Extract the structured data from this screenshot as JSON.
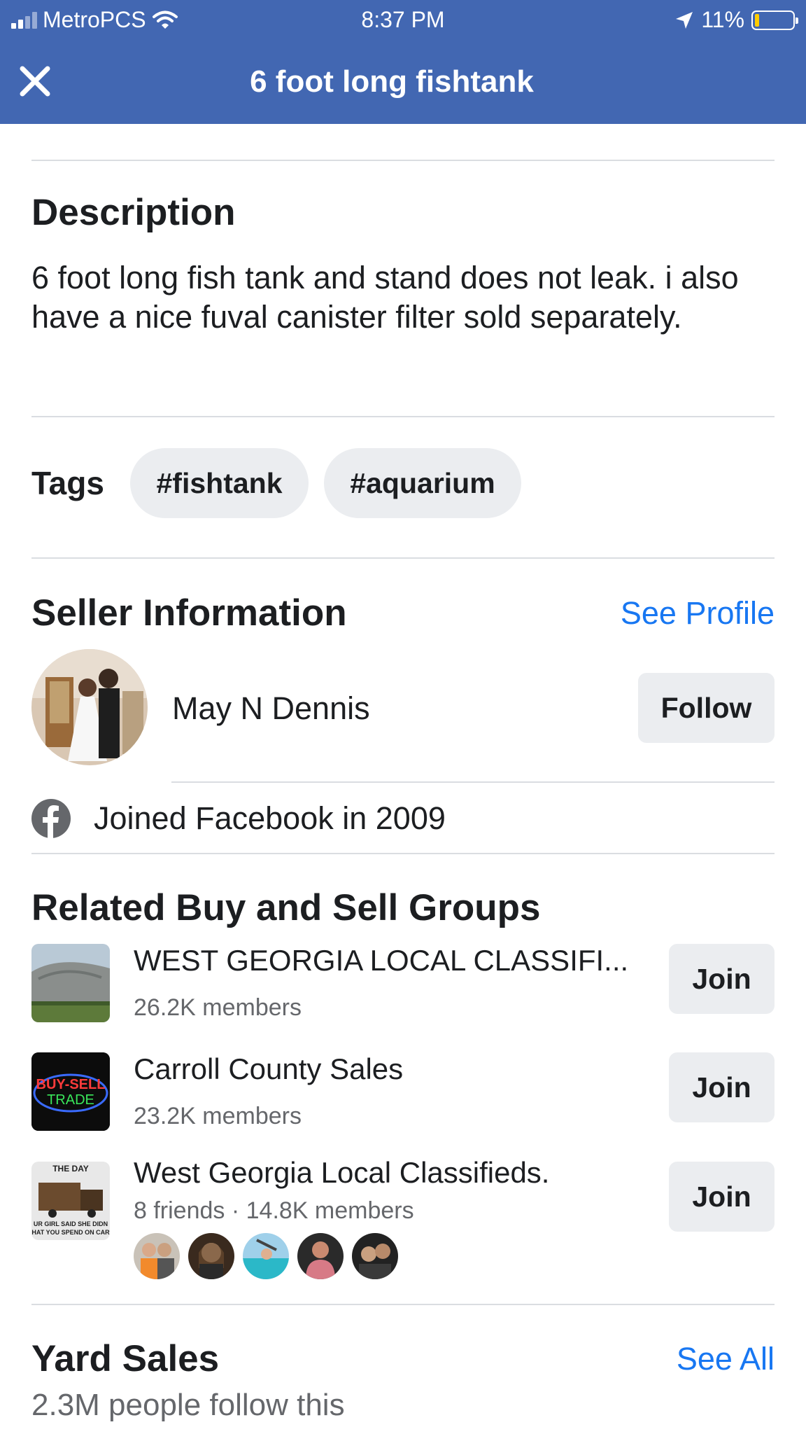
{
  "status_bar": {
    "carrier": "MetroPCS",
    "time": "8:37 PM",
    "battery": "11%",
    "battery_level": 0.11
  },
  "header": {
    "close_icon": "close-icon",
    "title": "6 foot long fishtank"
  },
  "description": {
    "heading": "Description",
    "text": "6 foot long fish tank and stand does not leak. i also have a nice fuval canister filter sold separately."
  },
  "tags": {
    "label": "Tags",
    "items": [
      "#fishtank",
      "#aquarium"
    ]
  },
  "seller": {
    "heading": "Seller Information",
    "see_profile": "See Profile",
    "name": "May N Dennis",
    "follow": "Follow",
    "joined": "Joined Facebook in 2009",
    "joined_icon": "facebook-icon"
  },
  "related": {
    "heading": "Related Buy and Sell Groups",
    "groups": [
      {
        "title": "WEST GEORGIA LOCAL CLASSIFI...",
        "members": "26.2K members",
        "join": "Join"
      },
      {
        "title": "Carroll County Sales",
        "members": "23.2K members",
        "join": "Join",
        "thumb_text_1": "BUY-SELL",
        "thumb_text_2": "TRADE"
      },
      {
        "title": "West Georgia Local Classifieds.",
        "members": "8 friends · 14.8K members",
        "join": "Join",
        "thumb_text_1": "THE DAY",
        "thumb_text_2": "UR GIRL SAID SHE DIDN",
        "thumb_text_3": "HAT YOU SPEND ON CAR"
      }
    ]
  },
  "yard_sales": {
    "title": "Yard Sales",
    "see_all": "See All",
    "followers": "2.3M people follow this"
  },
  "colors": {
    "header_bg": "#4267b2",
    "link": "#1877f2",
    "button_bg": "#ebedf0",
    "divider": "#dadde1"
  }
}
